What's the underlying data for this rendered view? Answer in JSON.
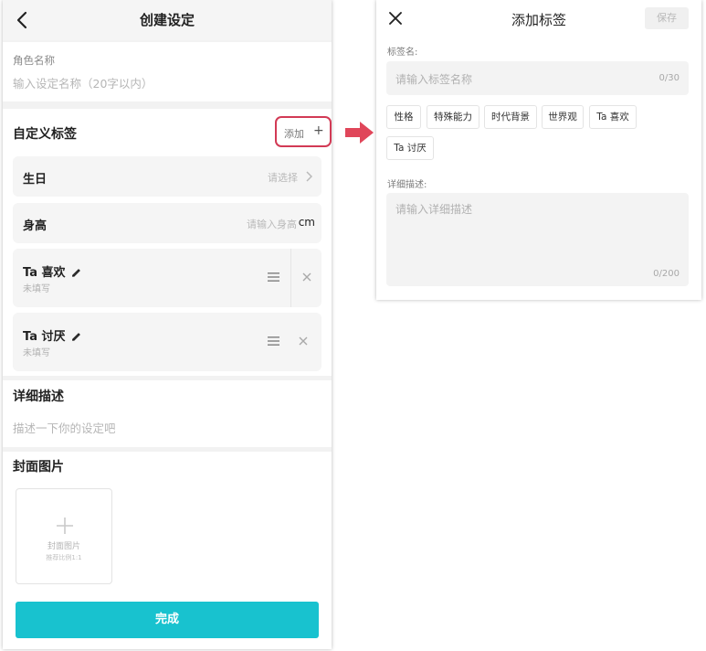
{
  "left": {
    "title": "创建设定",
    "role_name_label": "角色名称",
    "role_name_placeholder": "输入设定名称（20字以内）",
    "custom_tags_title": "自定义标签",
    "add_label": "添加",
    "add_plus": "+",
    "rows": {
      "birthday": {
        "label": "生日",
        "hint": "请选择"
      },
      "height": {
        "label": "身高",
        "hint": "请输入身高",
        "unit": "cm"
      },
      "likes": {
        "label": "Ta 喜欢",
        "sub": "未填写"
      },
      "dislikes": {
        "label": "Ta 讨厌",
        "sub": "未填写"
      }
    },
    "detail_title": "详细描述",
    "detail_placeholder": "描述一下你的设定吧",
    "cover_title": "封面图片",
    "cover_box_label": "封面图片",
    "cover_box_hint": "推荐比例1:1",
    "done_button": "完成"
  },
  "right": {
    "title": "添加标签",
    "save_button": "保存",
    "tag_name_label": "标签名:",
    "tag_name_placeholder": "请输入标签名称",
    "tag_name_counter": "0/30",
    "suggestions": [
      "性格",
      "特殊能力",
      "时代背景",
      "世界观",
      "Ta 喜欢",
      "Ta 讨厌"
    ],
    "detail_label": "详细描述:",
    "detail_placeholder": "请输入详细描述",
    "detail_counter": "0/200"
  },
  "colors": {
    "accent": "#18c2cf",
    "highlight": "#d23a55",
    "arrow": "#e0465a"
  },
  "icons": [
    "back-chevron-icon",
    "chevron-right-icon",
    "edit-pencil-icon",
    "drag-handle-icon",
    "delete-x-icon",
    "plus-icon",
    "close-icon",
    "right-arrow-icon"
  ]
}
